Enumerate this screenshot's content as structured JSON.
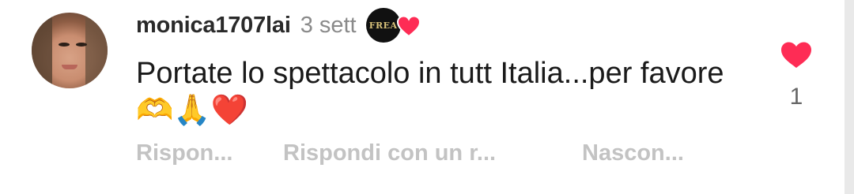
{
  "comment": {
    "username": "monica1707lai",
    "time": "3 sett",
    "creator_badge_text": "FREA",
    "text": "Portate lo spettacolo in tutt Italia...per favore 🫶🙏❤️",
    "like_count": "1",
    "actions": {
      "reply": "Rispon...",
      "reply_gif": "Rispondi con un r...",
      "hide": "Nascon..."
    }
  },
  "icons": {
    "like": "heart-icon",
    "creator_liked": "creator-heart-icon"
  },
  "colors": {
    "heart": "#fe2c55",
    "username": "#2a2a2a",
    "meta": "#8a8a8a",
    "action": "#c3c3c3"
  }
}
